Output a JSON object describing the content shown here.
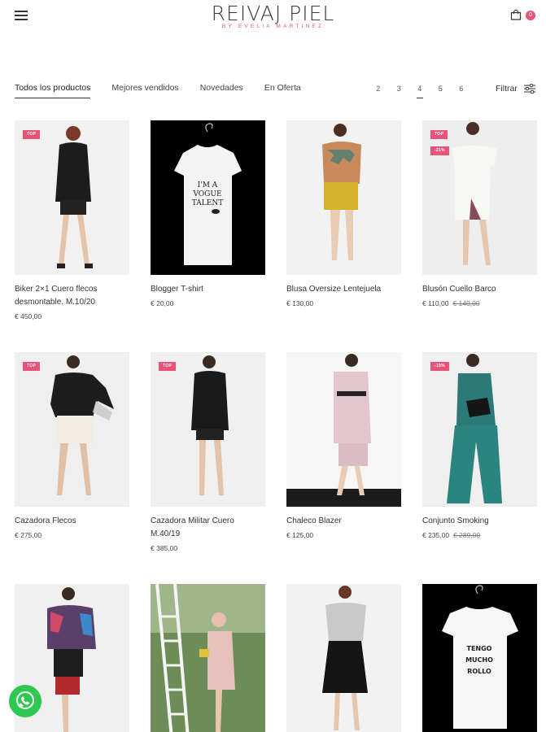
{
  "header": {
    "logo_title": "REIVAJ PIEL",
    "logo_subtitle": "BY EVELIA MARTINEZ",
    "cart_count": "0"
  },
  "tabs": [
    {
      "label": "Todos los productos",
      "active": true
    },
    {
      "label": "Mejores vendidos",
      "active": false
    },
    {
      "label": "Novedades",
      "active": false
    },
    {
      "label": "En Oferta",
      "active": false
    }
  ],
  "pagination": {
    "pages": [
      "2",
      "3",
      "4",
      "5",
      "6"
    ],
    "current": "4"
  },
  "filter_label": "Filtrar",
  "products": [
    {
      "name": "Biker 2×1 Cuero flecos desmontable. M.10/20",
      "price": "€ 450,00",
      "old_price": "",
      "badges": [
        "TOP"
      ]
    },
    {
      "name": "Blogger T-shirt",
      "price": "€ 20,00",
      "old_price": "",
      "badges": []
    },
    {
      "name": "Blusa Oversize Lentejuela",
      "price": "€ 130,00",
      "old_price": "",
      "badges": []
    },
    {
      "name": "Blusón Cuello Barco",
      "price": "€ 110,00",
      "old_price": "€ 140,00",
      "badges": [
        "TOP",
        "-21%"
      ]
    },
    {
      "name": "Cazadora Flecos",
      "price": "€ 275,00",
      "old_price": "",
      "badges": [
        "TOP"
      ]
    },
    {
      "name": "Cazadora Militar Cuero M.40/19",
      "price": "€ 385,00",
      "old_price": "",
      "badges": [
        "TOP"
      ]
    },
    {
      "name": "Chaleco Blazer",
      "price": "€ 125,00",
      "old_price": "",
      "badges": []
    },
    {
      "name": "Conjunto Smoking",
      "price": "€ 235,00",
      "old_price": "€ 289,00",
      "badges": [
        "-19%"
      ]
    },
    {
      "name": "",
      "price": "",
      "old_price": "",
      "badges": []
    },
    {
      "name": "",
      "price": "",
      "old_price": "",
      "badges": []
    },
    {
      "name": "",
      "price": "",
      "old_price": "",
      "badges": []
    },
    {
      "name": "",
      "price": "",
      "old_price": "",
      "badges": []
    }
  ],
  "tshirt_texts": {
    "blogger": [
      "I'M A",
      "VOGUE",
      "TALENT"
    ],
    "tengo": [
      "TENGO",
      "MUCHO",
      "ROLLO"
    ]
  },
  "colors": {
    "accent": "#e8537a",
    "whatsapp": "#2cc84f"
  }
}
